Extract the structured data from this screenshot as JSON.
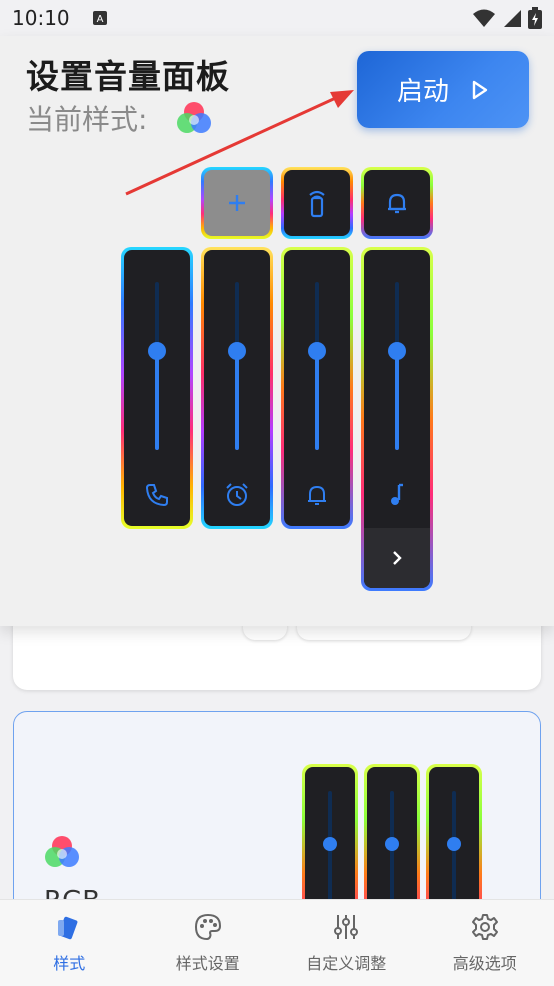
{
  "status": {
    "time": "10:10"
  },
  "header": {
    "title": "设置音量面板",
    "subtitle": "当前样式:",
    "start_label": "启动"
  },
  "panel": {
    "top_buttons": [
      {
        "icon": "plus-icon",
        "active": true
      },
      {
        "icon": "vibrate-icon"
      },
      {
        "icon": "bell-icon"
      }
    ],
    "sliders": [
      {
        "icon": "phone-icon",
        "level": 0.6
      },
      {
        "icon": "alarm-icon",
        "level": 0.6
      },
      {
        "icon": "bell-icon",
        "level": 0.6
      },
      {
        "icon": "music-icon",
        "level": 0.6,
        "expandable": true
      }
    ]
  },
  "cards": [
    {
      "name": "RGB",
      "sliders": [
        0.35,
        0.35,
        0.35
      ]
    }
  ],
  "nav": {
    "items": [
      {
        "label": "样式",
        "icon": "style-icon",
        "active": true
      },
      {
        "label": "样式设置",
        "icon": "palette-icon"
      },
      {
        "label": "自定义调整",
        "icon": "sliders-icon"
      },
      {
        "label": "高级选项",
        "icon": "gear-icon"
      }
    ]
  },
  "colors": {
    "accent": "#2f6fe3",
    "arrow": "#e53935"
  }
}
